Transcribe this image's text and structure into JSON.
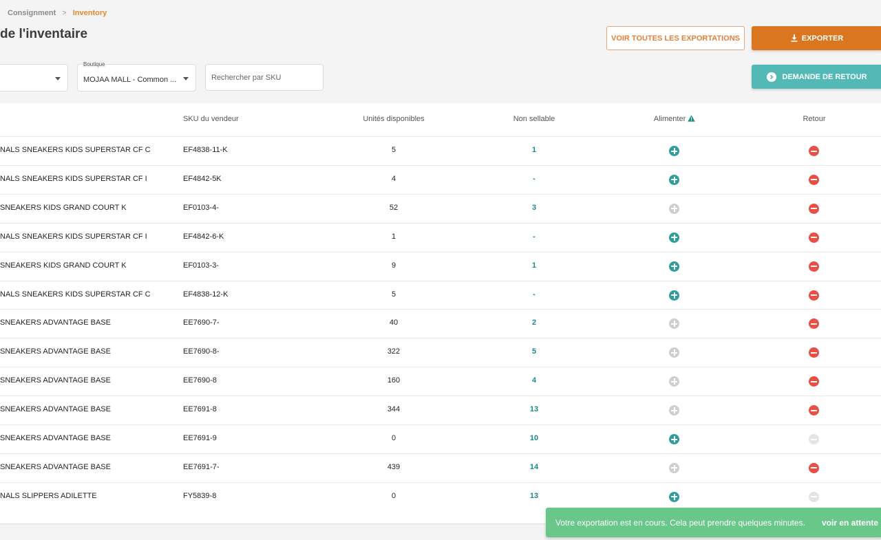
{
  "breadcrumb": {
    "parent": "Consignment",
    "separator": ">",
    "current": "Inventory"
  },
  "page": {
    "title": "de l'inventaire"
  },
  "actions": {
    "view_exports": "VOIR TOUTES LES EXPORTATIONS",
    "export": "EXPORTER",
    "return_request": "DEMANDE DE RETOUR"
  },
  "filters": {
    "boutique_label": "Boutique",
    "boutique_value": "MOJAA MALL - Common ...",
    "search_placeholder": "Rechercher par SKU"
  },
  "table": {
    "columns": {
      "sku": "SKU du vendeur",
      "units": "Unités disponibles",
      "non_sellable": "Non sellable",
      "alimenter": "Alimenter",
      "retour": "Retour"
    },
    "rows": [
      {
        "name": "NALS SNEAKERS KIDS SUPERSTAR CF C",
        "sku": "EF4838-11-K",
        "units": "5",
        "non": "1",
        "alim": "active",
        "ret": "active"
      },
      {
        "name": "NALS SNEAKERS KIDS SUPERSTAR CF I",
        "sku": "EF4842-5K",
        "units": "4",
        "non": "-",
        "alim": "active",
        "ret": "active"
      },
      {
        "name": "SNEAKERS KIDS GRAND COURT K",
        "sku": "EF0103-4-",
        "units": "52",
        "non": "3",
        "alim": "disabled",
        "ret": "active"
      },
      {
        "name": "NALS SNEAKERS KIDS SUPERSTAR CF I",
        "sku": "EF4842-6-K",
        "units": "1",
        "non": "-",
        "alim": "active",
        "ret": "active"
      },
      {
        "name": "SNEAKERS KIDS GRAND COURT K",
        "sku": "EF0103-3-",
        "units": "9",
        "non": "1",
        "alim": "active",
        "ret": "active"
      },
      {
        "name": "NALS SNEAKERS KIDS SUPERSTAR CF C",
        "sku": "EF4838-12-K",
        "units": "5",
        "non": "-",
        "alim": "active",
        "ret": "active"
      },
      {
        "name": "SNEAKERS ADVANTAGE BASE",
        "sku": "EE7690-7-",
        "units": "40",
        "non": "2",
        "alim": "disabled",
        "ret": "active"
      },
      {
        "name": "SNEAKERS ADVANTAGE BASE",
        "sku": "EE7690-8-",
        "units": "322",
        "non": "5",
        "alim": "disabled",
        "ret": "active"
      },
      {
        "name": "SNEAKERS ADVANTAGE BASE",
        "sku": "EE7690-8",
        "units": "160",
        "non": "4",
        "alim": "disabled",
        "ret": "active"
      },
      {
        "name": "SNEAKERS ADVANTAGE BASE",
        "sku": "EE7691-8",
        "units": "344",
        "non": "13",
        "alim": "disabled",
        "ret": "active"
      },
      {
        "name": "SNEAKERS ADVANTAGE BASE",
        "sku": "EE7691-9",
        "units": "0",
        "non": "10",
        "alim": "active",
        "ret": "disabled"
      },
      {
        "name": "SNEAKERS ADVANTAGE BASE",
        "sku": "EE7691-7-",
        "units": "439",
        "non": "14",
        "alim": "disabled",
        "ret": "active"
      },
      {
        "name": "NALS SLIPPERS ADILETTE",
        "sku": "FY5839-8",
        "units": "0",
        "non": "13",
        "alim": "active",
        "ret": "disabled"
      }
    ]
  },
  "toast": {
    "message": "Votre exportation est en cours. Cela peut prendre quelques minutes.",
    "action": "voir en attente"
  },
  "icons": {
    "add": "plus-circle-icon",
    "remove": "minus-circle-icon",
    "warning": "warning-triangle-icon",
    "download": "download-icon",
    "chevron": "chevron-right-circle-icon"
  },
  "colors": {
    "accent_orange": "#d9761f",
    "teal": "#53b9b6",
    "active_add": "#2f9e9a",
    "remove_red": "#e94f45",
    "toast_green": "#69c789"
  }
}
